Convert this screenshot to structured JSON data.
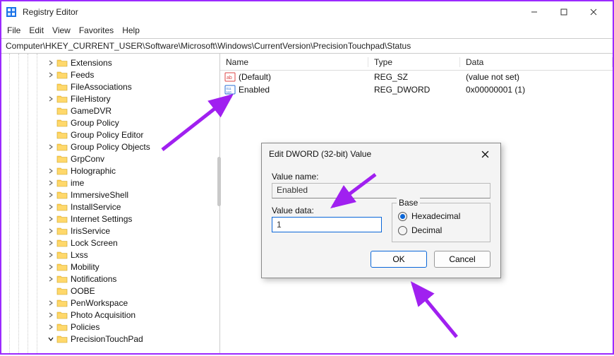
{
  "window": {
    "title": "Registry Editor"
  },
  "menu": {
    "file": "File",
    "edit": "Edit",
    "view": "View",
    "favorites": "Favorites",
    "help": "Help"
  },
  "address": "Computer\\HKEY_CURRENT_USER\\Software\\Microsoft\\Windows\\CurrentVersion\\PrecisionTouchpad\\Status",
  "tree": {
    "items": [
      {
        "label": "Extensions",
        "chevron": "right"
      },
      {
        "label": "Feeds",
        "chevron": "right"
      },
      {
        "label": "FileAssociations",
        "chevron": "none"
      },
      {
        "label": "FileHistory",
        "chevron": "right"
      },
      {
        "label": "GameDVR",
        "chevron": "none"
      },
      {
        "label": "Group Policy",
        "chevron": "none"
      },
      {
        "label": "Group Policy Editor",
        "chevron": "none"
      },
      {
        "label": "Group Policy Objects",
        "chevron": "right"
      },
      {
        "label": "GrpConv",
        "chevron": "none"
      },
      {
        "label": "Holographic",
        "chevron": "right"
      },
      {
        "label": "ime",
        "chevron": "right"
      },
      {
        "label": "ImmersiveShell",
        "chevron": "right"
      },
      {
        "label": "InstallService",
        "chevron": "right"
      },
      {
        "label": "Internet Settings",
        "chevron": "right"
      },
      {
        "label": "IrisService",
        "chevron": "right"
      },
      {
        "label": "Lock Screen",
        "chevron": "right"
      },
      {
        "label": "Lxss",
        "chevron": "right"
      },
      {
        "label": "Mobility",
        "chevron": "right"
      },
      {
        "label": "Notifications",
        "chevron": "right"
      },
      {
        "label": "OOBE",
        "chevron": "none"
      },
      {
        "label": "PenWorkspace",
        "chevron": "right"
      },
      {
        "label": "Photo Acquisition",
        "chevron": "right"
      },
      {
        "label": "Policies",
        "chevron": "right"
      },
      {
        "label": "PrecisionTouchPad",
        "chevron": "down"
      }
    ]
  },
  "list": {
    "headers": {
      "name": "Name",
      "type": "Type",
      "data": "Data"
    },
    "rows": [
      {
        "icon": "string",
        "name": "(Default)",
        "type": "REG_SZ",
        "data": "(value not set)"
      },
      {
        "icon": "binary",
        "name": "Enabled",
        "type": "REG_DWORD",
        "data": "0x00000001 (1)"
      }
    ]
  },
  "dialog": {
    "title": "Edit DWORD (32-bit) Value",
    "value_name_label": "Value name:",
    "value_name": "Enabled",
    "value_data_label": "Value data:",
    "value_data": "1",
    "base_label": "Base",
    "hex_label": "Hexadecimal",
    "dec_label": "Decimal",
    "ok": "OK",
    "cancel": "Cancel"
  }
}
